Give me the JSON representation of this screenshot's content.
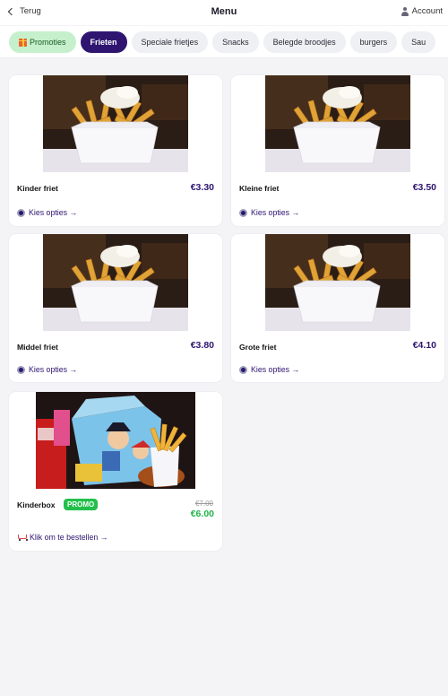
{
  "header": {
    "back_label": "Terug",
    "title": "Menu",
    "account_label": "Account"
  },
  "categories": [
    {
      "label": "Promoties",
      "icon": "gift-icon",
      "state": "promo"
    },
    {
      "label": "Frieten",
      "state": "active"
    },
    {
      "label": "Speciale frietjes"
    },
    {
      "label": "Snacks"
    },
    {
      "label": "Belegde broodjes"
    },
    {
      "label": "burgers"
    },
    {
      "label": "Sau"
    }
  ],
  "products": [
    {
      "name": "Kinder friet",
      "price": "€3.30",
      "action": "Kies opties →",
      "action_icon": "gear-icon"
    },
    {
      "name": "Kleine friet",
      "price": "€3.50",
      "action": "Kies opties →",
      "action_icon": "gear-icon"
    },
    {
      "name": "Middel friet",
      "price": "€3.80",
      "action": "Kies opties →",
      "action_icon": "gear-icon"
    },
    {
      "name": "Grote friet",
      "price": "€4.10",
      "action": "Kies opties →",
      "action_icon": "gear-icon"
    },
    {
      "name": "Kinderbox",
      "badge": "PROMO",
      "old_price": "€7.00",
      "price": "€6.00",
      "action": "Klik om te bestellen →",
      "action_icon": "cart-icon"
    }
  ],
  "colors": {
    "brand": "#2f1570",
    "promo_green": "#22c04a",
    "promo_chip": "#c6f0cc"
  }
}
